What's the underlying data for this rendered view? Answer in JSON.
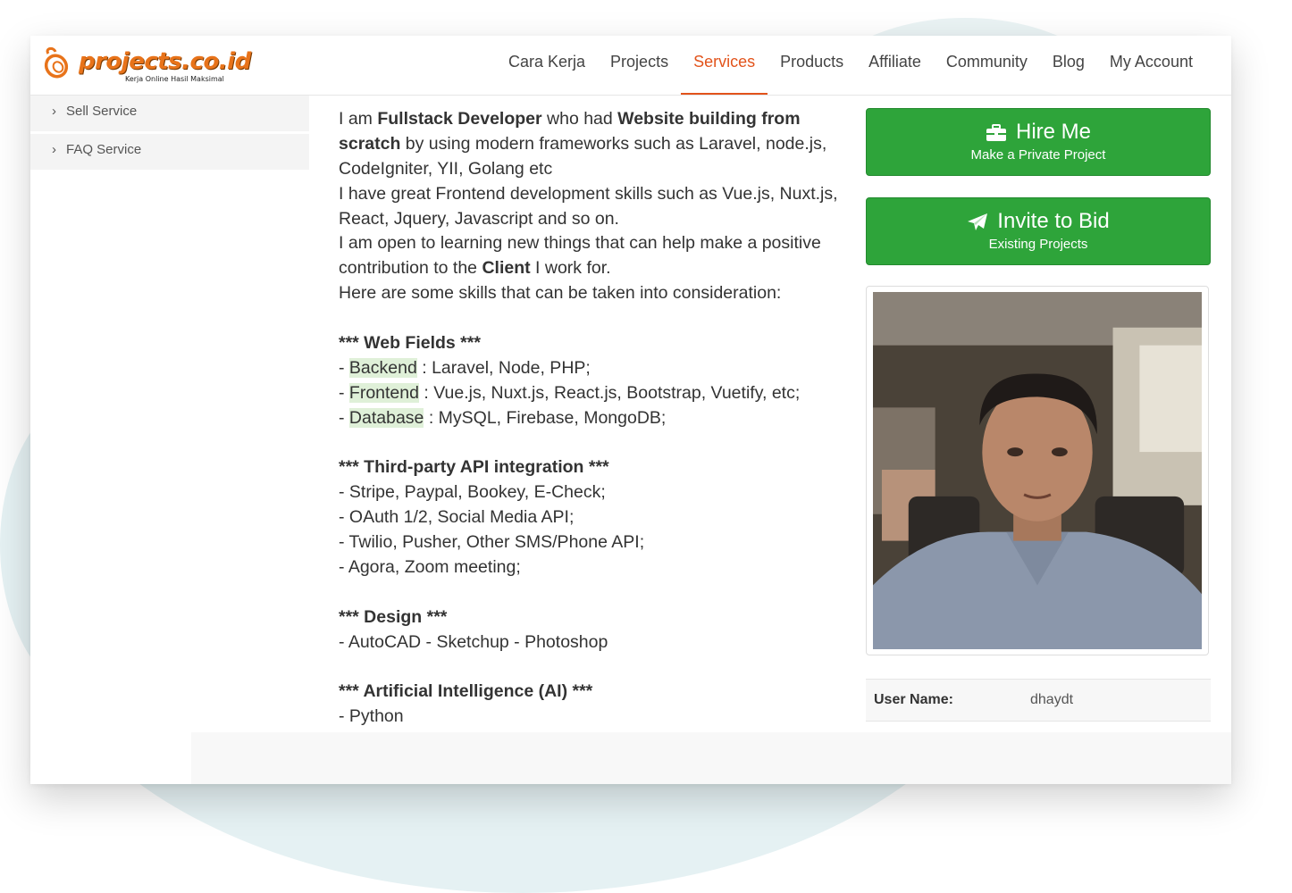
{
  "brand": {
    "logo_text": "projects.co.id",
    "tagline": "Kerja Online Hasil Maksimal",
    "accent": "#e2531b",
    "green": "#2ea43a"
  },
  "nav": {
    "items": [
      {
        "label": "Cara Kerja",
        "active": false
      },
      {
        "label": "Projects",
        "active": false
      },
      {
        "label": "Services",
        "active": true
      },
      {
        "label": "Products",
        "active": false
      },
      {
        "label": "Affiliate",
        "active": false
      },
      {
        "label": "Community",
        "active": false
      },
      {
        "label": "Blog",
        "active": false
      },
      {
        "label": "My Account",
        "active": false
      }
    ]
  },
  "sidebar": {
    "items": [
      {
        "label": "Sell Service",
        "icon": "chevron-right-icon"
      },
      {
        "label": "FAQ Service",
        "icon": "chevron-right-icon"
      }
    ]
  },
  "description": {
    "p1_a": "I am ",
    "p1_b": "Fullstack Developer",
    "p1_c": " who had ",
    "p1_d": "Website building from",
    "p1_e": "scratch",
    "p1_f": " by using modern frameworks such as Laravel, node.js,",
    "p1_g": "CodeIgniter, YII, Golang etc",
    "p2_a": "I have great Frontend development skills such as Vue.js, Nuxt.js,",
    "p2_b": "React, Jquery, Javascript and so on.",
    "p3_a": "I am open to learning new things that can help make a positive",
    "p3_b": "contribution to the ",
    "p3_c": "Client",
    "p3_d": " I work for.",
    "p4": "Here are some skills that can be taken into consideration:",
    "web_title": "*** Web Fields ***",
    "web_backend_key": "Backend",
    "web_backend_val": " : Laravel, Node, PHP;",
    "web_frontend_key": "Frontend",
    "web_frontend_val": " : Vue.js, Nuxt.js, React.js, Bootstrap, Vuetify, etc;",
    "web_database_key": "Database",
    "web_database_val": " : MySQL, Firebase, MongoDB;",
    "dash": "- ",
    "api_title": "*** Third-party API integration ***",
    "api_1": "- Stripe, Paypal, Bookey, E-Check;",
    "api_2": " - OAuth 1/2, Social Media API;",
    "api_3": "- Twilio, Pusher, Other SMS/Phone API;",
    "api_4": "- Agora, Zoom meeting;",
    "design_title": " *** Design ***",
    "design_1": "- AutoCAD - Sketchup - Photoshop",
    "ai_title": "*** Artificial Intelligence (AI) ***",
    "ai_1": "- Python"
  },
  "actions": {
    "hire_label": "Hire Me",
    "hire_sub": "Make a Private Project",
    "hire_icon": "briefcase-icon",
    "invite_label": "Invite to Bid",
    "invite_sub": "Existing Projects",
    "invite_icon": "paper-plane-icon"
  },
  "profile": {
    "user_name_label": "User Name:",
    "user_name_value": "dhaydt"
  }
}
